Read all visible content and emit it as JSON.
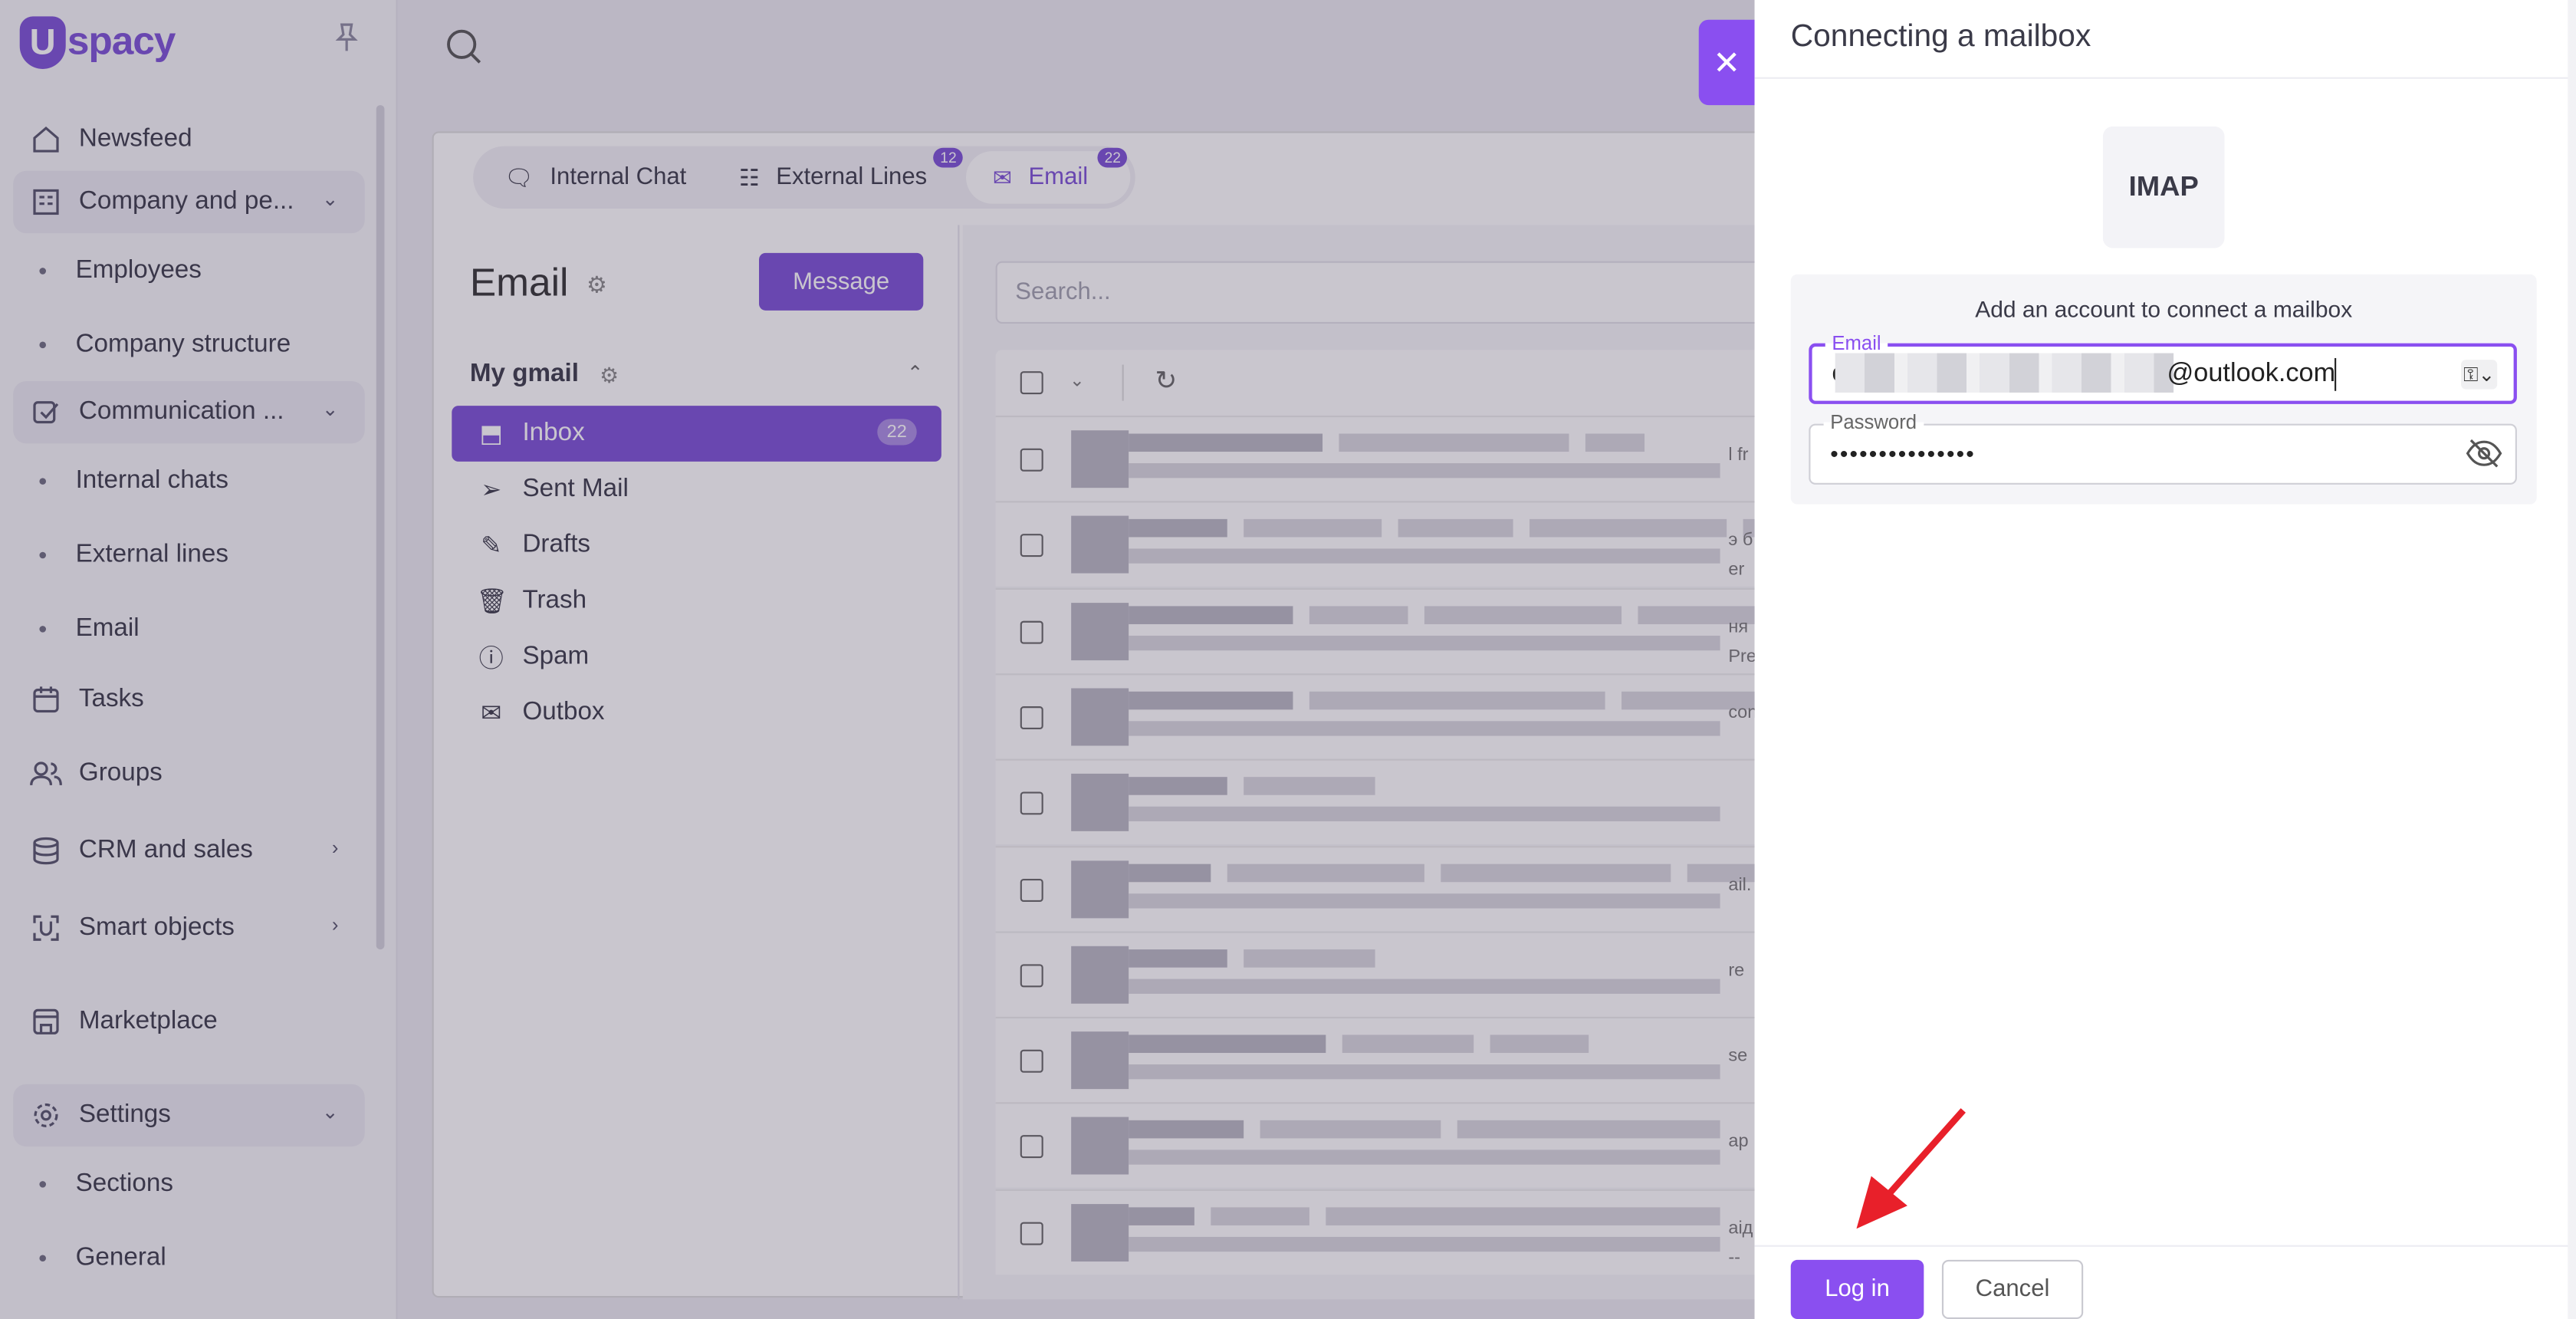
{
  "app": {
    "logo_initial": "U",
    "logo_rest": "spacy"
  },
  "sidebar": {
    "items": [
      {
        "label": "Newsfeed",
        "icon": "home-icon"
      },
      {
        "label": "Company and pe...",
        "icon": "building-icon",
        "children": [
          "Employees",
          "Company structure"
        ]
      },
      {
        "label": "Communication ...",
        "icon": "communication-icon",
        "children": [
          "Internal chats",
          "External lines",
          "Email"
        ]
      },
      {
        "label": "Tasks",
        "icon": "calendar-icon"
      },
      {
        "label": "Groups",
        "icon": "groups-icon"
      },
      {
        "label": "CRM and sales",
        "icon": "database-icon"
      },
      {
        "label": "Smart objects",
        "icon": "smart-object-icon"
      },
      {
        "label": "Marketplace",
        "icon": "store-icon"
      },
      {
        "label": "Settings",
        "icon": "gear-icon",
        "children": [
          "Sections",
          "General"
        ]
      }
    ]
  },
  "main": {
    "tabs": [
      {
        "label": "Internal Chat"
      },
      {
        "label": "External Lines",
        "badge": "12"
      },
      {
        "label": "Email",
        "badge": "22"
      }
    ],
    "email_title": "Email",
    "message_button": "Message",
    "account_name": "My gmail",
    "folders": [
      {
        "label": "Inbox",
        "count": "22"
      },
      {
        "label": "Sent Mail"
      },
      {
        "label": "Drafts"
      },
      {
        "label": "Trash"
      },
      {
        "label": "Spam"
      },
      {
        "label": "Outbox"
      }
    ],
    "search_placeholder": "Search...",
    "row_side_text": [
      "l fr",
      "э б\ner",
      "ня\nPre",
      "con",
      "",
      "ail.",
      "re",
      "se",
      "ар",
      "аід\n--"
    ]
  },
  "dialog": {
    "title": "Connecting a mailbox",
    "protocol": "IMAP",
    "card_title": "Add an account to connect a mailbox",
    "email_label": "Email",
    "email_value_prefix": "c",
    "email_value_suffix": "@outlook.com",
    "password_label": "Password",
    "password_value": "•••••••••••••••",
    "login_button": "Log in",
    "cancel_button": "Cancel"
  },
  "colors": {
    "accent": "#8a4ff0",
    "brand": "#7b4fd6",
    "arrow": "#e8202a"
  }
}
